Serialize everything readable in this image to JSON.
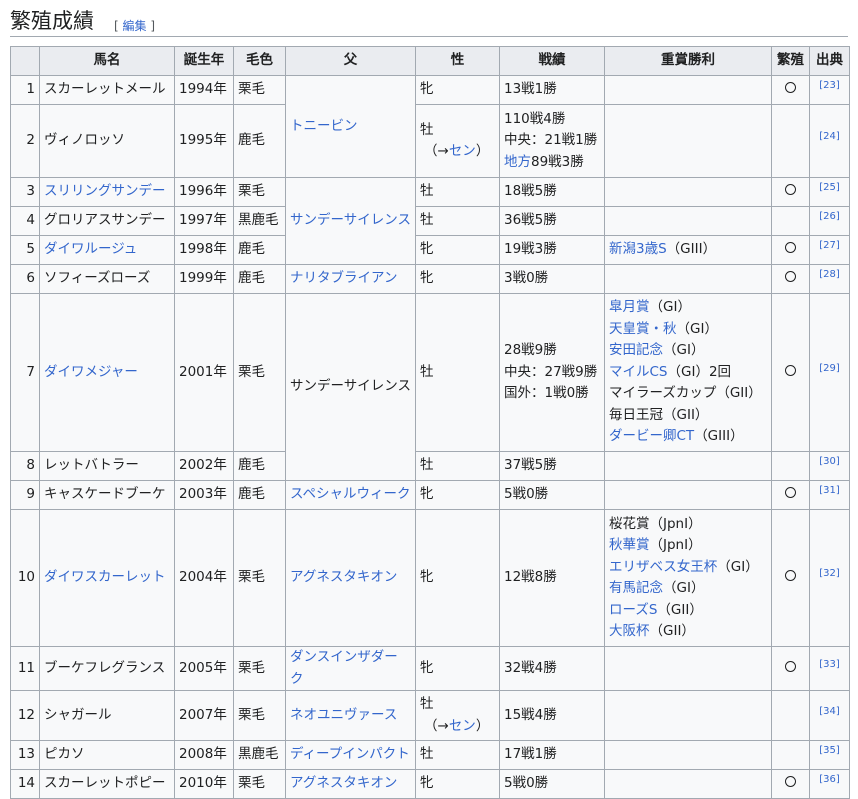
{
  "heading": {
    "title": "繁殖成績",
    "edit_open": "[",
    "edit_label": "編集",
    "edit_close": "]"
  },
  "columns": [
    "",
    "馬名",
    "誕生年",
    "毛色",
    "父",
    "性",
    "戦績",
    "重賞勝利",
    "繁殖",
    "出典"
  ],
  "rows": [
    {
      "no": "1",
      "name": "スカーレットメール",
      "name_link": false,
      "year": "1994年",
      "color": "栗毛",
      "sire": "トニービン",
      "sire_link": true,
      "sex": [
        "牝"
      ],
      "record": [
        "13戦1勝"
      ],
      "wins": [],
      "breeding": true,
      "ref": "[23]"
    },
    {
      "no": "2",
      "name": "ヴィノロッソ",
      "name_link": false,
      "year": "1995年",
      "color": "鹿毛",
      "sire": "トニービン",
      "sire_link": true,
      "sex": [
        "牡",
        "（→セン）"
      ],
      "record": [
        "110戦4勝",
        "中央：21戦1勝",
        "地方89戦3勝"
      ],
      "wins": [],
      "breeding": false,
      "ref": "[24]"
    },
    {
      "no": "3",
      "name": "スリリングサンデー",
      "name_link": true,
      "year": "1996年",
      "color": "栗毛",
      "sire": "サンデーサイレンス",
      "sire_link": true,
      "sex": [
        "牡"
      ],
      "record": [
        "18戦5勝"
      ],
      "wins": [],
      "breeding": true,
      "ref": "[25]"
    },
    {
      "no": "4",
      "name": "グロリアスサンデー",
      "name_link": false,
      "year": "1997年",
      "color": "黒鹿毛",
      "sire": "サンデーサイレンス",
      "sire_link": true,
      "sex": [
        "牡"
      ],
      "record": [
        "36戦5勝"
      ],
      "wins": [],
      "breeding": false,
      "ref": "[26]"
    },
    {
      "no": "5",
      "name": "ダイワルージュ",
      "name_link": true,
      "year": "1998年",
      "color": "鹿毛",
      "sire": "サンデーサイレンス",
      "sire_link": true,
      "sex": [
        "牝"
      ],
      "record": [
        "19戦3勝"
      ],
      "wins": [
        "新潟3歳S（GIII）"
      ],
      "breeding": true,
      "ref": "[27]"
    },
    {
      "no": "6",
      "name": "ソフィーズローズ",
      "name_link": false,
      "year": "1999年",
      "color": "鹿毛",
      "sire": "ナリタブライアン",
      "sire_link": true,
      "sex": [
        "牝"
      ],
      "record": [
        "3戦0勝"
      ],
      "wins": [],
      "breeding": true,
      "ref": "[28]"
    },
    {
      "no": "7",
      "name": "ダイワメジャー",
      "name_link": true,
      "year": "2001年",
      "color": "栗毛",
      "sire": "サンデーサイレンス",
      "sire_link": false,
      "sex": [
        "牡"
      ],
      "record": [
        "28戦9勝",
        "中央：27戦9勝",
        "国外：1戦0勝"
      ],
      "wins": [
        "皐月賞（GI）",
        "天皇賞・秋（GI）",
        "安田記念（GI）",
        "マイルCS（GI）2回",
        "マイラーズカップ（GII）",
        "毎日王冠（GII）",
        "ダービー卿CT（GIII）"
      ],
      "breeding": true,
      "ref": "[29]"
    },
    {
      "no": "8",
      "name": "レットバトラー",
      "name_link": false,
      "year": "2002年",
      "color": "鹿毛",
      "sire": "サンデーサイレンス",
      "sire_link": false,
      "sex": [
        "牡"
      ],
      "record": [
        "37戦5勝"
      ],
      "wins": [],
      "breeding": false,
      "ref": "[30]"
    },
    {
      "no": "9",
      "name": "キャスケードブーケ",
      "name_link": false,
      "year": "2003年",
      "color": "鹿毛",
      "sire": "スペシャルウィーク",
      "sire_link": true,
      "sex": [
        "牝"
      ],
      "record": [
        "5戦0勝"
      ],
      "wins": [],
      "breeding": true,
      "ref": "[31]"
    },
    {
      "no": "10",
      "name": "ダイワスカーレット",
      "name_link": true,
      "year": "2004年",
      "color": "栗毛",
      "sire": "アグネスタキオン",
      "sire_link": true,
      "sex": [
        "牝"
      ],
      "record": [
        "12戦8勝"
      ],
      "wins": [
        "桜花賞（JpnI）",
        "秋華賞（JpnI）",
        "エリザベス女王杯（GI）",
        "有馬記念（GI）",
        "ローズS（GII）",
        "大阪杯（GII）"
      ],
      "breeding": true,
      "ref": "[32]"
    },
    {
      "no": "11",
      "name": "ブーケフレグランス",
      "name_link": false,
      "year": "2005年",
      "color": "栗毛",
      "sire": "ダンスインザダーク",
      "sire_link": true,
      "sex": [
        "牝"
      ],
      "record": [
        "32戦4勝"
      ],
      "wins": [],
      "breeding": true,
      "ref": "[33]"
    },
    {
      "no": "12",
      "name": "シャガール",
      "name_link": false,
      "year": "2007年",
      "color": "栗毛",
      "sire": "ネオユニヴァース",
      "sire_link": true,
      "sex": [
        "牡",
        "（→セン）"
      ],
      "record": [
        "15戦4勝"
      ],
      "wins": [],
      "breeding": false,
      "ref": "[34]"
    },
    {
      "no": "13",
      "name": "ピカソ",
      "name_link": false,
      "year": "2008年",
      "color": "黒鹿毛",
      "sire": "ディープインパクト",
      "sire_link": true,
      "sex": [
        "牡"
      ],
      "record": [
        "17戦1勝"
      ],
      "wins": [],
      "breeding": false,
      "ref": "[35]"
    },
    {
      "no": "14",
      "name": "スカーレットポピー",
      "name_link": false,
      "year": "2010年",
      "color": "栗毛",
      "sire": "アグネスタキオン",
      "sire_link": true,
      "sex": [
        "牝"
      ],
      "record": [
        "5戦0勝"
      ],
      "wins": [],
      "breeding": true,
      "ref": "[36]"
    }
  ],
  "links": {
    "sex_sen": "セン",
    "record_chiho": "地方",
    "win_links": [
      "新潟3歳S",
      "皐月賞",
      "天皇賞・秋",
      "安田記念",
      "マイルCS",
      "ダービー卿CT",
      "秋華賞",
      "エリザベス女王杯",
      "有馬記念",
      "ローズS",
      "大阪杯"
    ]
  },
  "colors": {
    "link": "#3366cc",
    "header_bg": "#eaecf0",
    "cell_bg": "#f8f9fa",
    "border": "#a2a9b1"
  }
}
